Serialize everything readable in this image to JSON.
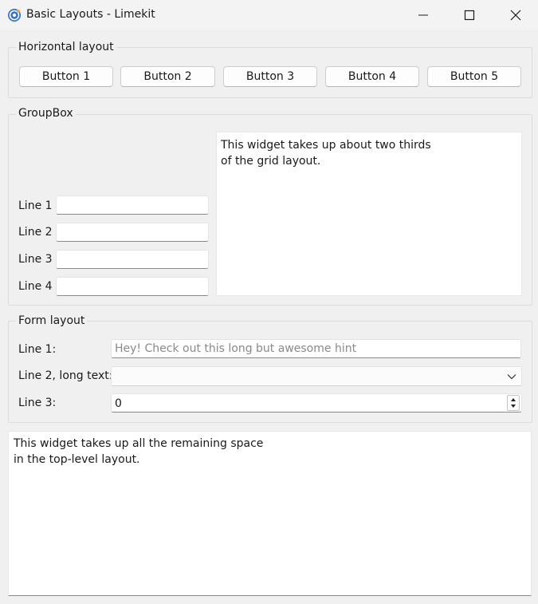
{
  "window": {
    "title": "Basic Layouts - Limekit",
    "icon": "limekit-app-icon"
  },
  "horizontal_group": {
    "title": "Horizontal layout",
    "buttons": [
      "Button 1",
      "Button 2",
      "Button 3",
      "Button 4",
      "Button 5"
    ]
  },
  "grid_group": {
    "title": "GroupBox",
    "lines": [
      "Line 1",
      "Line 2",
      "Line 3",
      "Line 4"
    ],
    "text_edit": "This widget takes up about two thirds\nof the grid layout."
  },
  "form_group": {
    "title": "Form layout",
    "line1_label": "Line 1:",
    "line1_placeholder": "Hey! Check out this long but awesome hint",
    "line2_label": "Line 2, long text:",
    "line2_value": "",
    "line3_label": "Line 3:",
    "line3_value": "0"
  },
  "bottom_text": "This widget takes up all the remaining space\nin the top-level layout."
}
